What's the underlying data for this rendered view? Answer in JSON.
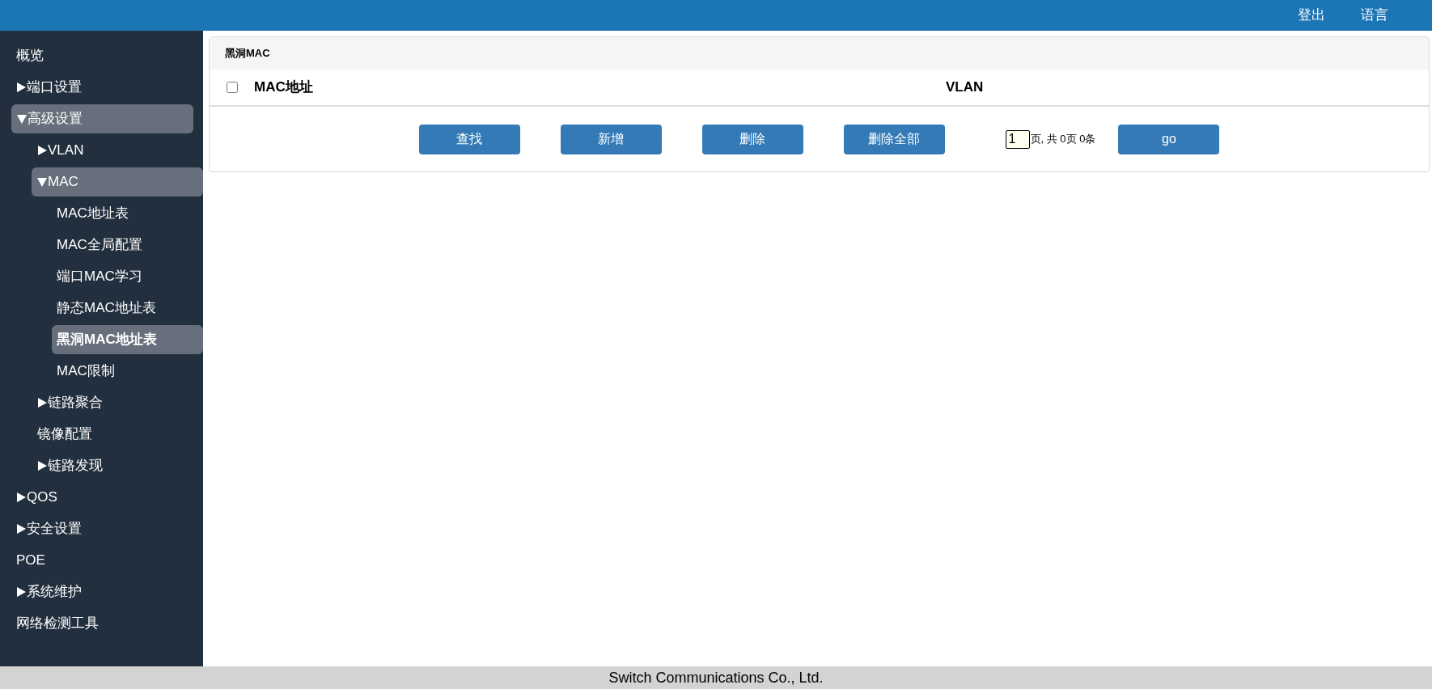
{
  "header": {
    "links": [
      "登出",
      "语言"
    ]
  },
  "sidebar": {
    "items": [
      {
        "label": "概览"
      },
      {
        "label": "端口设置",
        "expanded": false
      },
      {
        "label": "高级设置",
        "expanded": true,
        "children": [
          {
            "label": "VLAN",
            "expanded": false
          },
          {
            "label": "MAC",
            "expanded": true,
            "children": [
              {
                "label": "MAC地址表",
                "selected": false
              },
              {
                "label": "MAC全局配置",
                "selected": false
              },
              {
                "label": "端口MAC学习",
                "selected": false
              },
              {
                "label": "静态MAC地址表",
                "selected": false
              },
              {
                "label": "黑洞MAC地址表",
                "selected": true
              },
              {
                "label": "MAC限制",
                "selected": false
              }
            ]
          },
          {
            "label": "链路聚合",
            "expanded": false
          },
          {
            "label": "镜像配置"
          },
          {
            "label": "链路发现",
            "expanded": false
          }
        ]
      },
      {
        "label": "QOS",
        "expanded": false
      },
      {
        "label": "安全设置",
        "expanded": false
      },
      {
        "label": "POE"
      },
      {
        "label": "系统维护",
        "expanded": false
      },
      {
        "label": "网络检测工具"
      }
    ]
  },
  "panel": {
    "title": "黑洞MAC",
    "table": {
      "select_all": {
        "checked": false
      },
      "columns": [
        "MAC地址",
        "VLAN"
      ]
    },
    "buttons": [
      "查找",
      "新增",
      "删除",
      "删除全部"
    ],
    "pager": {
      "page": "1",
      "summary": "页, 共 0页 0条",
      "go": "go"
    }
  },
  "footer": {
    "text": "Switch Communications Co., Ltd."
  }
}
